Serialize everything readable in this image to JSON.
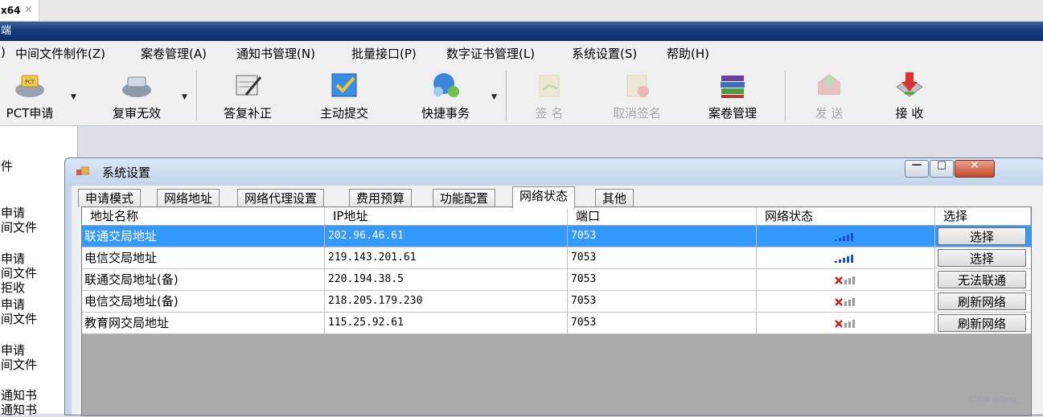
{
  "browser_tab": {
    "label": "x64",
    "close_glyph": "✕"
  },
  "app": {
    "title_fragment": "端"
  },
  "menu": [
    {
      "label": ")"
    },
    {
      "label": "中间文件制作(Z)"
    },
    {
      "label": "案卷管理(A)"
    },
    {
      "label": "通知书管理(N)"
    },
    {
      "label": "批量接口(P)"
    },
    {
      "label": "数字证书管理(L)"
    },
    {
      "label": "系统设置(S)"
    },
    {
      "label": "帮助(H)"
    }
  ],
  "toolbar": {
    "items": [
      {
        "label": "PCT申请",
        "icon": "pct-icon",
        "enabled": true
      },
      {
        "label": "复审无效",
        "icon": "review-icon",
        "enabled": true
      },
      {
        "label": "答复补正",
        "icon": "reply-edit-icon",
        "enabled": true
      },
      {
        "label": "主动提交",
        "icon": "submit-check-icon",
        "enabled": true
      },
      {
        "label": "快捷事务",
        "icon": "quick-task-icon",
        "enabled": true
      },
      {
        "label": "签 名",
        "icon": "sign-icon",
        "enabled": false
      },
      {
        "label": "取消签名",
        "icon": "cancel-sign-icon",
        "enabled": false
      },
      {
        "label": "案卷管理",
        "icon": "books-icon",
        "enabled": true
      },
      {
        "label": "发 送",
        "icon": "send-icon",
        "enabled": false
      },
      {
        "label": "接 收",
        "icon": "receive-icon",
        "enabled": true
      }
    ],
    "dropdown_glyph": "▼"
  },
  "left_panel": {
    "items": [
      "件",
      "申请",
      "间文件",
      "申请",
      "间文件",
      "拒收",
      "申请",
      "间文件",
      "申请",
      "间文件",
      "通知书",
      "通知书"
    ]
  },
  "dialog": {
    "title": "系统设置",
    "buttons": {
      "minimize": "—",
      "maximize": "□",
      "close": "✕"
    },
    "tabs": [
      "申请模式",
      "网络地址",
      "网络代理设置",
      "费用预算",
      "功能配置",
      "网络状态",
      "其他"
    ],
    "active_tab": "网络状态",
    "grid": {
      "columns": [
        "地址名称",
        "IP地址",
        "端口",
        "网络状态",
        "选择"
      ],
      "rows": [
        {
          "name": "联通交局地址",
          "ip": "202.96.46.61",
          "port": "7053",
          "status": "signal-ok",
          "action": "选择",
          "selected": true
        },
        {
          "name": "电信交局地址",
          "ip": "219.143.201.61",
          "port": "7053",
          "status": "signal-ok",
          "action": "选择",
          "selected": false
        },
        {
          "name": "联通交局地址(备)",
          "ip": "220.194.38.5",
          "port": "7053",
          "status": "signal-fail",
          "action": "无法联通",
          "selected": false
        },
        {
          "name": "电信交局地址(备)",
          "ip": "218.205.179.230",
          "port": "7053",
          "status": "signal-fail",
          "action": "刷新网络",
          "selected": false
        },
        {
          "name": "教育网交局地址",
          "ip": "115.25.92.61",
          "port": "7053",
          "status": "signal-fail",
          "action": "刷新网络",
          "selected": false
        }
      ]
    }
  },
  "watermark": "CSDN @Qing_"
}
